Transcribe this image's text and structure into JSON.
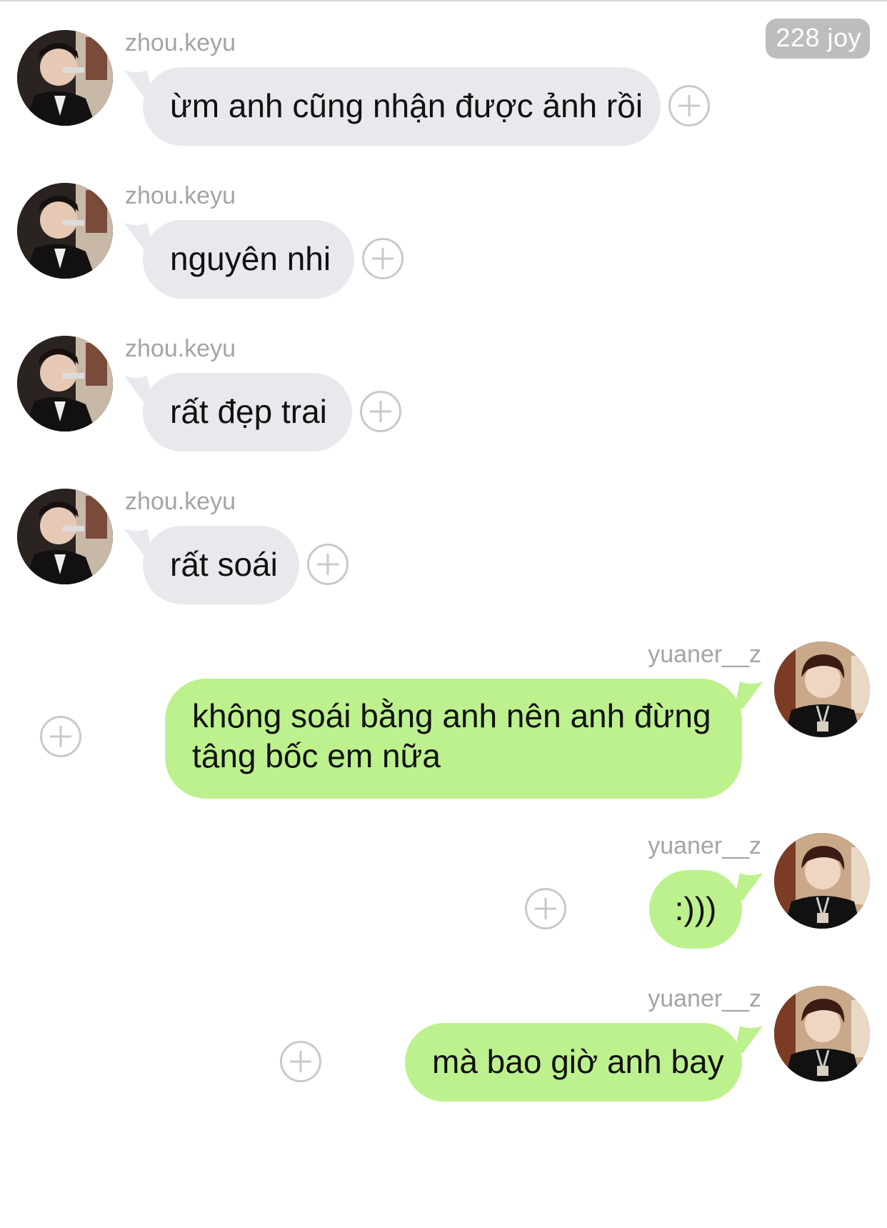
{
  "header": {
    "badge": "228 joy"
  },
  "colors": {
    "incoming_bubble": "#e8e9ec",
    "outgoing_bubble": "#bdf18d",
    "username": "#a4a4a4",
    "badge_bg": "#bdbdbd"
  },
  "messages": [
    {
      "direction": "incoming",
      "username": "zhou.keyu",
      "text": "ừm anh cũng nhận được ảnh rồi",
      "avatar_icon": "avatar-photo-icon"
    },
    {
      "direction": "incoming",
      "username": "zhou.keyu",
      "text": "nguyên nhi",
      "avatar_icon": "avatar-photo-icon"
    },
    {
      "direction": "incoming",
      "username": "zhou.keyu",
      "text": "rất đẹp trai",
      "avatar_icon": "avatar-photo-icon"
    },
    {
      "direction": "incoming",
      "username": "zhou.keyu",
      "text": "rất soái",
      "avatar_icon": "avatar-photo-icon"
    },
    {
      "direction": "outgoing",
      "username": "yuaner__z",
      "text_lines": [
        "không soái bằng anh nên anh đừng",
        "tâng bốc em nữa"
      ],
      "avatar_icon": "avatar-photo-icon"
    },
    {
      "direction": "outgoing",
      "username": "yuaner__z",
      "text": ":)))",
      "avatar_icon": "avatar-photo-icon"
    },
    {
      "direction": "outgoing",
      "username": "yuaner__z",
      "text": "mà bao giờ anh bay",
      "avatar_icon": "avatar-photo-icon"
    }
  ],
  "icons": {
    "react": "plus-circle-icon"
  }
}
